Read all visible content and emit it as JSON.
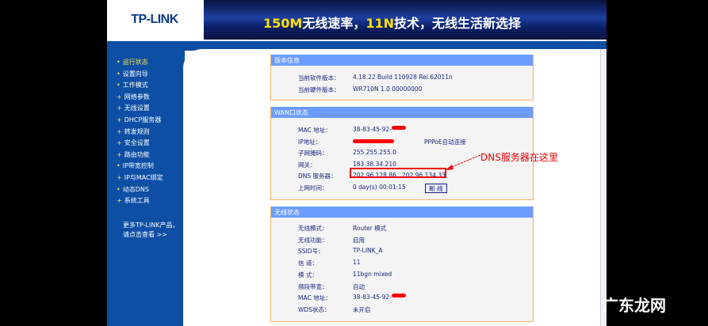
{
  "header": {
    "logo": "TP-LINK",
    "banner_1": "150M",
    "banner_2": "无线速率，",
    "banner_3": "11N",
    "banner_4": "技术，无线生活新选择"
  },
  "sidebar": {
    "items": [
      "运行状态",
      "设置向导",
      "工作模式",
      "网络参数",
      "无线设置",
      "DHCP服务器",
      "转发规则",
      "安全设置",
      "路由功能",
      "IP带宽控制",
      "IP与MAC绑定",
      "动态DNS",
      "系统工具"
    ],
    "more_1": "更多TP-LINK产品，",
    "more_2": "请点击查看 >>"
  },
  "version": {
    "title": "版本信息",
    "rows": [
      {
        "k": "当前软件版本：",
        "v": "4.18.22 Build 110928 Rel.62011n"
      },
      {
        "k": "当前硬件版本：",
        "v": "WR710N 1.0 00000000"
      }
    ]
  },
  "wan": {
    "title": "WAN口状态",
    "mac_k": "MAC 地址：",
    "mac_v": "38-83-45-92-",
    "ip_k": "IP地址：",
    "ip_type": "PPPoE自动连接",
    "mask_k": "子网掩码：",
    "mask_v": "255.255.255.0",
    "gw_k": "网关：",
    "gw_v": "183.38.34.210",
    "dns_k": "DNS 服务器：",
    "dns_v": "202.96.128.86 , 202.96.134.33",
    "time_k": "上网时间：",
    "time_v": "0 day(s) 00:01:15",
    "disconnect": "断 线"
  },
  "annotation": "DNS服务器在这里",
  "wireless": {
    "title": "无线状态",
    "rows": [
      {
        "k": "无线模式：",
        "v": "Router 模式"
      },
      {
        "k": "无线功能：",
        "v": "启用"
      },
      {
        "k": "SSID号：",
        "v": "TP-LINK_A"
      },
      {
        "k": "信 道：",
        "v": "11"
      },
      {
        "k": "模 式：",
        "v": "11bgn mixed"
      },
      {
        "k": "频段带宽：",
        "v": "自动"
      },
      {
        "k": "MAC 地址：",
        "v": "38-83-45-92-"
      },
      {
        "k": "WDS状态：",
        "v": "未开启"
      }
    ]
  },
  "watermark": "广东龙网"
}
